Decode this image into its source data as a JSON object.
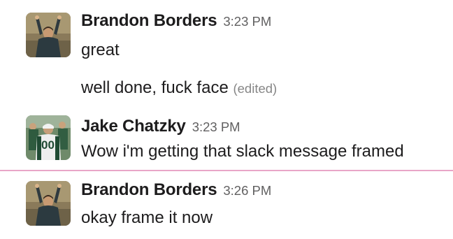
{
  "messages": [
    {
      "sender": "Brandon Borders",
      "time": "3:23 PM",
      "avatar_icon": "man-raising-arms-avatar",
      "lines": [
        {
          "text": "great",
          "edited": ""
        },
        {
          "text": "well done, fuck face",
          "edited": "(edited)"
        }
      ]
    },
    {
      "sender": "Jake Chatzky",
      "time": "3:23 PM",
      "avatar_icon": "football-jersey-avatar",
      "lines": [
        {
          "text": "Wow i'm getting that slack message framed",
          "edited": ""
        }
      ]
    },
    {
      "sender": "Brandon Borders",
      "time": "3:26 PM",
      "avatar_icon": "man-raising-arms-avatar",
      "lines": [
        {
          "text": "okay frame it now",
          "edited": ""
        }
      ]
    }
  ],
  "jersey_number": "00",
  "new_messages_divider_color": "#e8a6c8"
}
